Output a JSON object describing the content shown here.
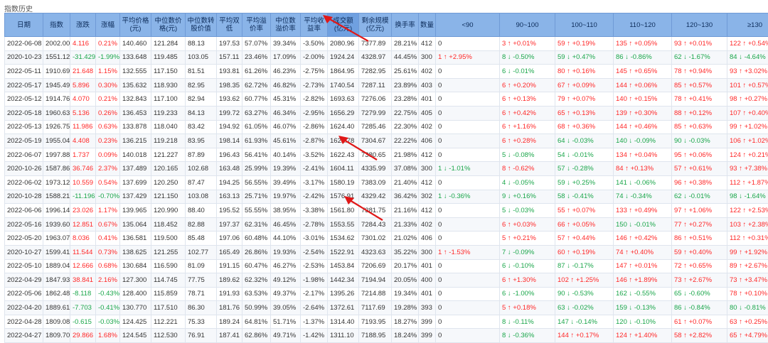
{
  "page": {
    "title": "指数历史"
  },
  "columns": [
    "日期",
    "指数",
    "涨跌",
    "涨幅",
    "平均价格(元)",
    "中位数价格(元)",
    "中位数转股价值",
    "平均双低",
    "平均溢价率",
    "中位数溢价率",
    "平均收益率",
    "成交额(亿元)",
    "剩余规模(亿元)",
    "换手率",
    "数量",
    "<90",
    "90~100",
    "100~110",
    "110~120",
    "120~130",
    "≥130"
  ],
  "sorted_column": "成交额(亿元)",
  "colors": {
    "up": "#ff2828",
    "down": "#1aa64a",
    "header": "#8ab4e8"
  },
  "rows": [
    [
      "2022-06-08",
      "2002.001",
      "4.116",
      "0.21%",
      "140.460",
      "121.284",
      "88.13",
      "197.53",
      "57.07%",
      "39.34%",
      "-3.50%",
      "2080.96",
      "7377.89",
      "28.21%",
      "412",
      "0",
      "3 ↑ +0.01%",
      "59 ↑ +0.19%",
      "135 ↑ +0.05%",
      "93 ↑ +0.01%",
      "122 ↑ +0.54%"
    ],
    [
      "2020-10-23",
      "1551.120",
      "-31.429",
      "-1.99%",
      "133.648",
      "119.485",
      "103.05",
      "157.11",
      "23.46%",
      "17.09%",
      "-2.00%",
      "1924.24",
      "4328.97",
      "44.45%",
      "300",
      "1 ↑ +2.95%",
      "8 ↓ -0.50%",
      "59 ↓ +0.47%",
      "86 ↓ -0.86%",
      "62 ↓ -1.67%",
      "84 ↓ -4.64%"
    ],
    [
      "2022-05-11",
      "1910.694",
      "21.648",
      "1.15%",
      "132.555",
      "117.150",
      "81.51",
      "193.81",
      "61.26%",
      "46.23%",
      "-2.75%",
      "1864.95",
      "7282.95",
      "25.61%",
      "402",
      "0",
      "6 ↓ -0.01%",
      "80 ↑ +0.16%",
      "145 ↑ +0.65%",
      "78 ↑ +0.94%",
      "93 ↑ +3.02%"
    ],
    [
      "2022-05-17",
      "1945.497",
      "5.896",
      "0.30%",
      "135.632",
      "118.930",
      "82.95",
      "198.35",
      "62.72%",
      "46.82%",
      "-2.73%",
      "1740.54",
      "7287.11",
      "23.89%",
      "403",
      "0",
      "6 ↑ +0.20%",
      "67 ↑ +0.09%",
      "144 ↑ +0.06%",
      "85 ↑ +0.57%",
      "101 ↑ +0.57%"
    ],
    [
      "2022-05-12",
      "1914.764",
      "4.070",
      "0.21%",
      "132.843",
      "117.100",
      "82.94",
      "193.62",
      "60.77%",
      "45.31%",
      "-2.82%",
      "1693.63",
      "7276.06",
      "23.28%",
      "401",
      "0",
      "6 ↑ +0.13%",
      "79 ↑ +0.07%",
      "140 ↑ +0.15%",
      "78 ↑ +0.41%",
      "98 ↑ +0.27%"
    ],
    [
      "2022-05-18",
      "1960.633",
      "5.136",
      "0.26%",
      "136.453",
      "119.233",
      "84.13",
      "199.72",
      "63.27%",
      "46.34%",
      "-2.95%",
      "1656.29",
      "7279.99",
      "22.75%",
      "405",
      "0",
      "6 ↑ +0.42%",
      "65 ↑ +0.13%",
      "139 ↑ +0.30%",
      "88 ↑ +0.12%",
      "107 ↑ +0.40%"
    ],
    [
      "2022-05-13",
      "1926.750",
      "11.986",
      "0.63%",
      "133.878",
      "118.040",
      "83.42",
      "194.92",
      "61.05%",
      "46.07%",
      "-2.86%",
      "1624.40",
      "7285.46",
      "22.30%",
      "402",
      "0",
      "6 ↑ +1.16%",
      "68 ↑ +0.36%",
      "144 ↑ +0.46%",
      "85 ↑ +0.63%",
      "99 ↑ +1.02%"
    ],
    [
      "2022-05-19",
      "1955.041",
      "4.408",
      "0.23%",
      "136.215",
      "119.218",
      "83.95",
      "198.14",
      "61.93%",
      "45.61%",
      "-2.87%",
      "1622.78",
      "7304.67",
      "22.22%",
      "406",
      "0",
      "6 ↑ +0.28%",
      "64 ↓ -0.03%",
      "140 ↓ -0.09%",
      "90 ↓ -0.03%",
      "106 ↑ +1.02%"
    ],
    [
      "2022-06-07",
      "1997.885",
      "1.737",
      "0.09%",
      "140.018",
      "121.227",
      "87.89",
      "196.43",
      "56.41%",
      "40.14%",
      "-3.52%",
      "1622.43",
      "7380.65",
      "21.98%",
      "412",
      "0",
      "5 ↓ -0.08%",
      "54 ↓ -0.01%",
      "134 ↑ +0.04%",
      "95 ↑ +0.06%",
      "124 ↑ +0.21%"
    ],
    [
      "2020-10-26",
      "1587.866",
      "36.746",
      "2.37%",
      "137.489",
      "120.165",
      "102.68",
      "163.48",
      "25.99%",
      "19.39%",
      "-2.41%",
      "1604.11",
      "4335.99",
      "37.08%",
      "300",
      "1 ↓ -1.01%",
      "8 ↑ -0.62%",
      "57 ↓ -0.28%",
      "84 ↑ +0.13%",
      "57 ↑ +0.61%",
      "93 ↑ +7.38%"
    ],
    [
      "2022-06-02",
      "1973.122",
      "10.559",
      "0.54%",
      "137.699",
      "120.250",
      "87.47",
      "194.25",
      "56.55%",
      "39.49%",
      "-3.17%",
      "1580.19",
      "7383.09",
      "21.40%",
      "412",
      "0",
      "4 ↓ -0.05%",
      "59 ↓ +0.25%",
      "141 ↓ -0.06%",
      "96 ↑ +0.38%",
      "112 ↑ +1.87%"
    ],
    [
      "2020-10-28",
      "1588.214",
      "-11.196",
      "-0.70%",
      "137.429",
      "121.150",
      "103.08",
      "163.13",
      "25.71%",
      "19.97%",
      "-2.42%",
      "1576.91",
      "4329.42",
      "36.42%",
      "302",
      "1 ↓ -0.36%",
      "9 ↓ +0.16%",
      "58 ↓ -0.41%",
      "74 ↓ -0.34%",
      "62 ↓ -0.01%",
      "98 ↓ -1.64%"
    ],
    [
      "2022-06-06",
      "1996.148",
      "23.026",
      "1.17%",
      "139.965",
      "120.990",
      "88.40",
      "195.52",
      "55.55%",
      "38.95%",
      "-3.38%",
      "1561.80",
      "7381.75",
      "21.16%",
      "412",
      "0",
      "5 ↓ -0.03%",
      "55 ↑ +0.07%",
      "133 ↑ +0.49%",
      "97 ↑ +1.06%",
      "122 ↑ +2.53%"
    ],
    [
      "2022-05-16",
      "1939.601",
      "12.851",
      "0.67%",
      "135.064",
      "118.452",
      "82.88",
      "197.37",
      "62.31%",
      "46.45%",
      "-2.78%",
      "1553.55",
      "7284.43",
      "21.33%",
      "402",
      "0",
      "6 ↑ +0.03%",
      "66 ↑ +0.05%",
      "150 ↓ -0.01%",
      "77 ↑ +0.27%",
      "103 ↑ +2.38%"
    ],
    [
      "2022-05-20",
      "1963.076",
      "8.036",
      "0.41%",
      "136.581",
      "119.500",
      "85.48",
      "197.06",
      "60.48%",
      "44.10%",
      "-3.01%",
      "1534.62",
      "7301.02",
      "21.02%",
      "406",
      "0",
      "5 ↑ +0.21%",
      "57 ↑ +0.44%",
      "146 ↑ +0.42%",
      "86 ↑ +0.51%",
      "112 ↑ +0.31%"
    ],
    [
      "2020-10-27",
      "1599.410",
      "11.544",
      "0.73%",
      "138.625",
      "121.255",
      "102.77",
      "165.49",
      "26.86%",
      "19.93%",
      "-2.54%",
      "1522.91",
      "4323.63",
      "35.22%",
      "300",
      "1 ↑ -1.53%",
      "7 ↓ -0.09%",
      "60 ↑ +0.19%",
      "74 ↑ +0.40%",
      "59 ↑ +0.40%",
      "99 ↑ +1.92%"
    ],
    [
      "2022-05-10",
      "1889.046",
      "12.666",
      "0.68%",
      "130.684",
      "116.590",
      "81.09",
      "191.15",
      "60.47%",
      "46.27%",
      "-2.53%",
      "1453.84",
      "7206.69",
      "20.17%",
      "401",
      "0",
      "6 ↓ -0.10%",
      "87 ↓ -0.17%",
      "147 ↑ +0.01%",
      "72 ↑ +0.65%",
      "89 ↑ +2.67%"
    ],
    [
      "2022-04-29",
      "1847.930",
      "38.841",
      "2.16%",
      "127.300",
      "114.745",
      "77.75",
      "189.62",
      "62.32%",
      "49.12%",
      "-1.98%",
      "1442.34",
      "7194.94",
      "20.05%",
      "400",
      "0",
      "6 ↑ +1.30%",
      "102 ↑ +1.25%",
      "146 ↑ +1.89%",
      "73 ↑ +2.67%",
      "73 ↑ +3.47%"
    ],
    [
      "2022-05-06",
      "1862.486",
      "-8.118",
      "-0.43%",
      "128.400",
      "115.859",
      "78.71",
      "191.93",
      "63.53%",
      "49.37%",
      "-2.17%",
      "1395.26",
      "7214.88",
      "19.34%",
      "401",
      "0",
      "6 ↓ -1.00%",
      "90 ↓ -0.53%",
      "162 ↓ -0.55%",
      "65 ↓ -0.60%",
      "78 ↑ +0.10%"
    ],
    [
      "2022-04-20",
      "1889.618",
      "-7.703",
      "-0.41%",
      "130.770",
      "117.510",
      "86.30",
      "181.76",
      "50.99%",
      "39.05%",
      "-2.64%",
      "1372.61",
      "7117.69",
      "19.28%",
      "393",
      "0",
      "5 ↑ +0.18%",
      "63 ↓ -0.02%",
      "159 ↓ -0.13%",
      "86 ↓ -0.84%",
      "80 ↓ -0.81%"
    ],
    [
      "2022-04-28",
      "1809.089",
      "-0.615",
      "-0.03%",
      "124.425",
      "112.221",
      "75.33",
      "189.24",
      "64.81%",
      "51.71%",
      "-1.37%",
      "1314.40",
      "7193.95",
      "18.27%",
      "399",
      "0",
      "8 ↓ -0.11%",
      "147 ↓ -0.14%",
      "120 ↓ -0.10%",
      "61 ↑ +0.07%",
      "63 ↑ +0.25%"
    ],
    [
      "2022-04-27",
      "1809.704",
      "29.866",
      "1.68%",
      "124.545",
      "112.530",
      "76.91",
      "187.41",
      "62.86%",
      "49.71%",
      "-1.42%",
      "1311.10",
      "7188.95",
      "18.24%",
      "399",
      "0",
      "8 ↓ -0.36%",
      "144 ↑ +0.17%",
      "124 ↑ +1.40%",
      "58 ↑ +2.82%",
      "65 ↑ +4.79%"
    ]
  ]
}
